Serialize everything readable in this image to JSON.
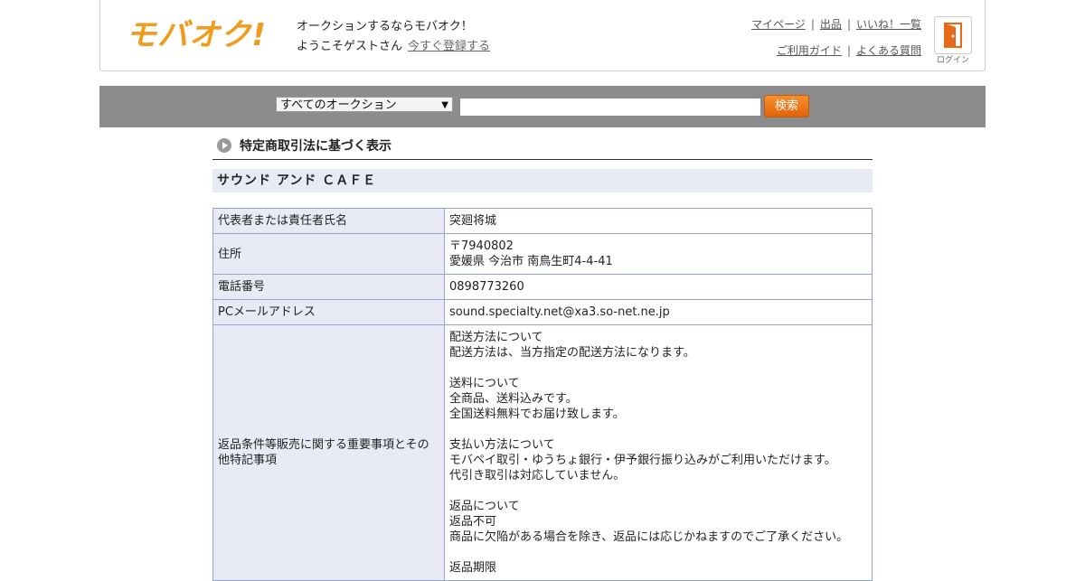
{
  "header": {
    "logo": "モバオク!",
    "tagline": "オークションするならモバオク！",
    "welcome": "ようこそゲストさん",
    "register_link": "今すぐ登録する",
    "nav_top": [
      "マイページ",
      "出品",
      "いいね！一覧"
    ],
    "nav_bottom": [
      "ご利用ガイド",
      "よくある質問"
    ],
    "login_label": "ログイン",
    "login_icon": "door-icon"
  },
  "search": {
    "category": "すべてのオークション",
    "query": "",
    "button": "検索"
  },
  "page": {
    "title": "特定商取引法に基づく表示",
    "shop_name": "サウンド アンド ＣＡＦＥ"
  },
  "table": {
    "rows": [
      {
        "label": "代表者または責任者氏名",
        "value": "突廻将城"
      },
      {
        "label": "住所",
        "value": "〒7940802\n愛媛県 今治市 南鳥生町4-4-41"
      },
      {
        "label": "電話番号",
        "value": "0898773260"
      },
      {
        "label": "PCメールアドレス",
        "value": "sound.specialty.net@xa3.so-net.ne.jp"
      },
      {
        "label": "返品条件等販売に関する重要事項とその他特記事項",
        "value": "配送方法について\n配送方法は、当方指定の配送方法になります。\n\n送料について\n全商品、送料込みです。\n全国送料無料でお届け致します。\n\n支払い方法について\nモバペイ取引・ゆうちょ銀行・伊予銀行振り込みがご利用いただけます。\n代引き取引は対応していません。\n\n返品について\n返品不可\n商品に欠陥がある場合を除き、返品には応じかねますのでご了承ください。\n\n返品期限"
      }
    ]
  },
  "colors": {
    "brand": "#f29a1a",
    "search_bar": "#8c8c8c",
    "label_bg": "#e8ebf6",
    "button": "#f07a1a"
  }
}
